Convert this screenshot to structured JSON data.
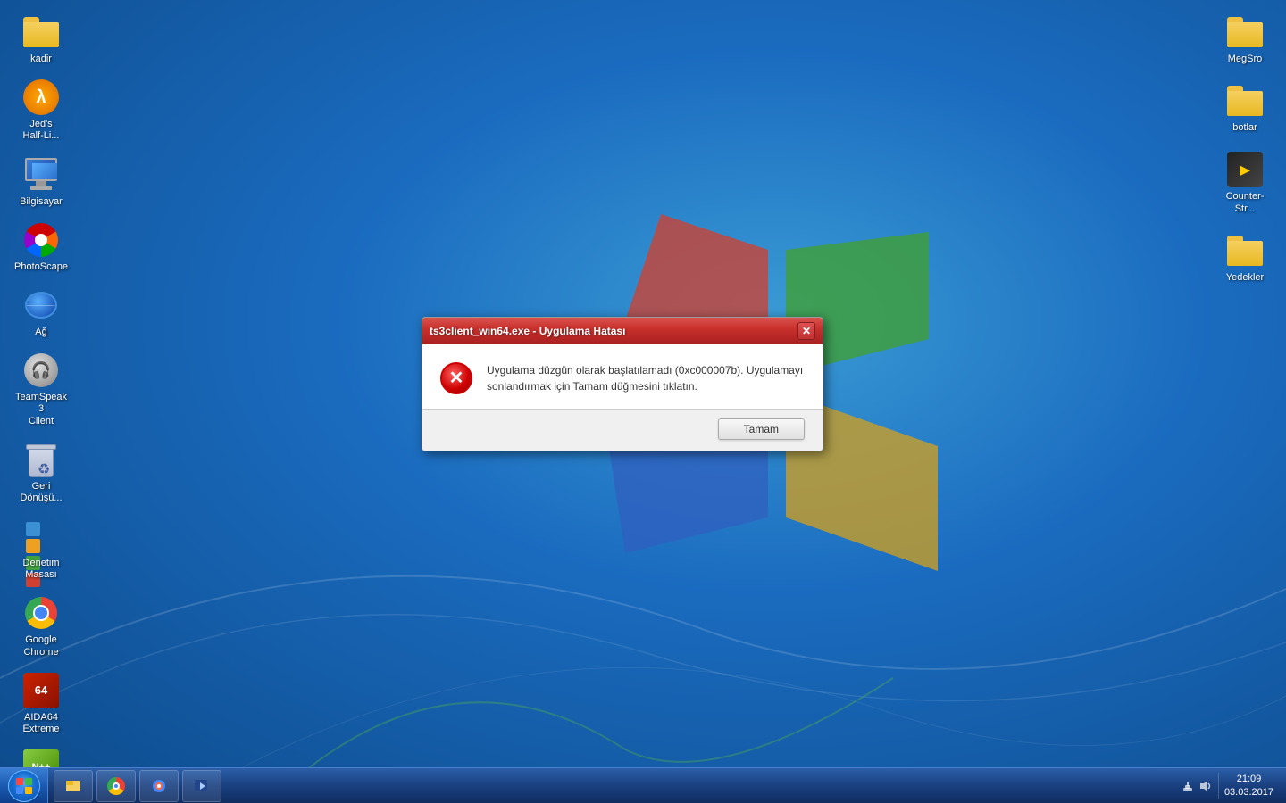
{
  "desktop": {
    "background_gradient": "radial-gradient(ellipse at 60% 40%, #3a9bd5 0%, #1a6bbf 40%, #0d4a8a 100%)"
  },
  "icons_left": [
    {
      "id": "kadir",
      "label": "kadir",
      "type": "folder"
    },
    {
      "id": "jeds-half-life",
      "label": "Jed's\nHalf-Li...",
      "type": "hl"
    },
    {
      "id": "bilgisayar",
      "label": "Bilgisayar",
      "type": "computer"
    },
    {
      "id": "photoscape",
      "label": "PhotoScape",
      "type": "photoscape"
    },
    {
      "id": "ag",
      "label": "Ağ",
      "type": "network"
    },
    {
      "id": "teamspeak",
      "label": "TeamSpeak 3\nClient",
      "type": "teamspeak"
    },
    {
      "id": "geri-donusum",
      "label": "Geri\nDönüşü...",
      "type": "recycle"
    },
    {
      "id": "denetim-masasi",
      "label": "Denetim\nMasası",
      "type": "controlpanel"
    },
    {
      "id": "google-chrome",
      "label": "Google\nChrome",
      "type": "chrome"
    },
    {
      "id": "aida64",
      "label": "AIDA64\nExtreme",
      "type": "aida64"
    },
    {
      "id": "notepadpp",
      "label": "Notepad++",
      "type": "notepad"
    }
  ],
  "icons_right": [
    {
      "id": "megsro",
      "label": "MegSro",
      "type": "folder"
    },
    {
      "id": "botlar",
      "label": "botlar",
      "type": "folder"
    },
    {
      "id": "counter-strike",
      "label": "Counter-Str...",
      "type": "cs"
    },
    {
      "id": "yedekler",
      "label": "Yedekler",
      "type": "folder"
    }
  ],
  "taskbar": {
    "start_label": "Start",
    "items": [
      {
        "id": "explorer",
        "label": "File Explorer"
      },
      {
        "id": "chrome-task",
        "label": "Google Chrome"
      },
      {
        "id": "paint",
        "label": "Paint"
      },
      {
        "id": "media",
        "label": "Media Player"
      }
    ],
    "clock_time": "21:09",
    "clock_date": "03.03.2017"
  },
  "dialog": {
    "title": "ts3client_win64.exe - Uygulama Hatası",
    "message": "Uygulama düzgün olarak başlatılamadı (0xc000007b). Uygulamayı sonlandırmak için Tamam düğmesini tıklatın.",
    "ok_button": "Tamam",
    "close_button": "✕"
  }
}
